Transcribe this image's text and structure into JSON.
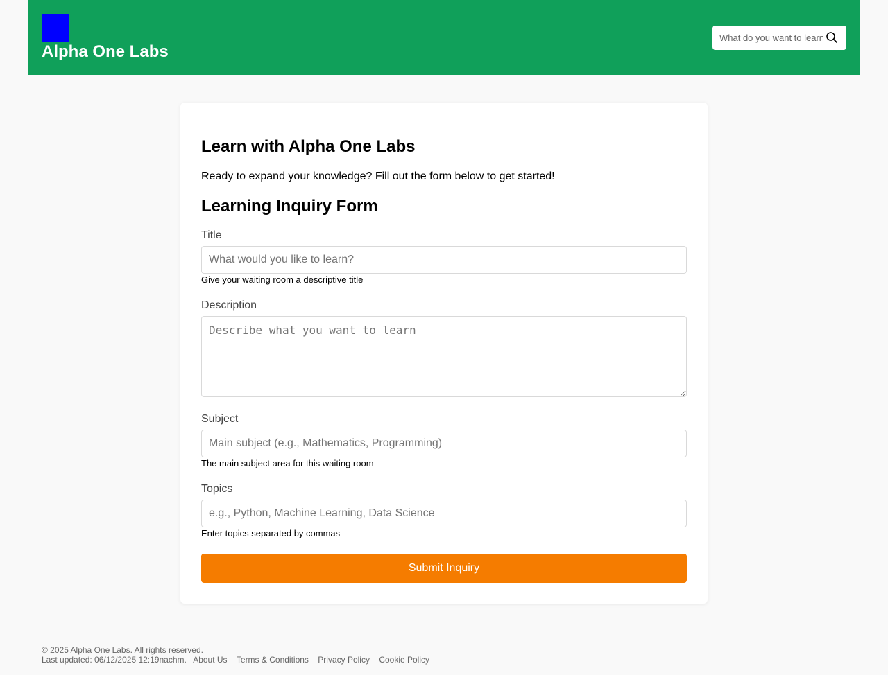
{
  "header": {
    "brand": "Alpha One Labs",
    "search_placeholder": "What do you want to learn?"
  },
  "main": {
    "heading": "Learn with Alpha One Labs",
    "intro": "Ready to expand your knowledge? Fill out the form below to get started!",
    "form_title": "Learning Inquiry Form",
    "fields": {
      "title": {
        "label": "Title",
        "placeholder": "What would you like to learn?",
        "help": "Give your waiting room a descriptive title"
      },
      "description": {
        "label": "Description",
        "placeholder": "Describe what you want to learn"
      },
      "subject": {
        "label": "Subject",
        "placeholder": "Main subject (e.g., Mathematics, Programming)",
        "help": "The main subject area for this waiting room"
      },
      "topics": {
        "label": "Topics",
        "placeholder": "e.g., Python, Machine Learning, Data Science",
        "help": "Enter topics separated by commas"
      }
    },
    "submit_label": "Submit Inquiry"
  },
  "footer": {
    "copyright": "© 2025 Alpha One Labs. All rights reserved.",
    "last_updated": "Last updated: 06/12/2025 12:19nachm.",
    "links": [
      "About Us",
      "Terms & Conditions",
      "Privacy Policy",
      "Cookie Policy"
    ]
  },
  "colors": {
    "header_bg": "#10a05a",
    "logo": "#0000ff",
    "submit_bg": "#f57c00"
  },
  "icons": {
    "search": "search-icon"
  }
}
